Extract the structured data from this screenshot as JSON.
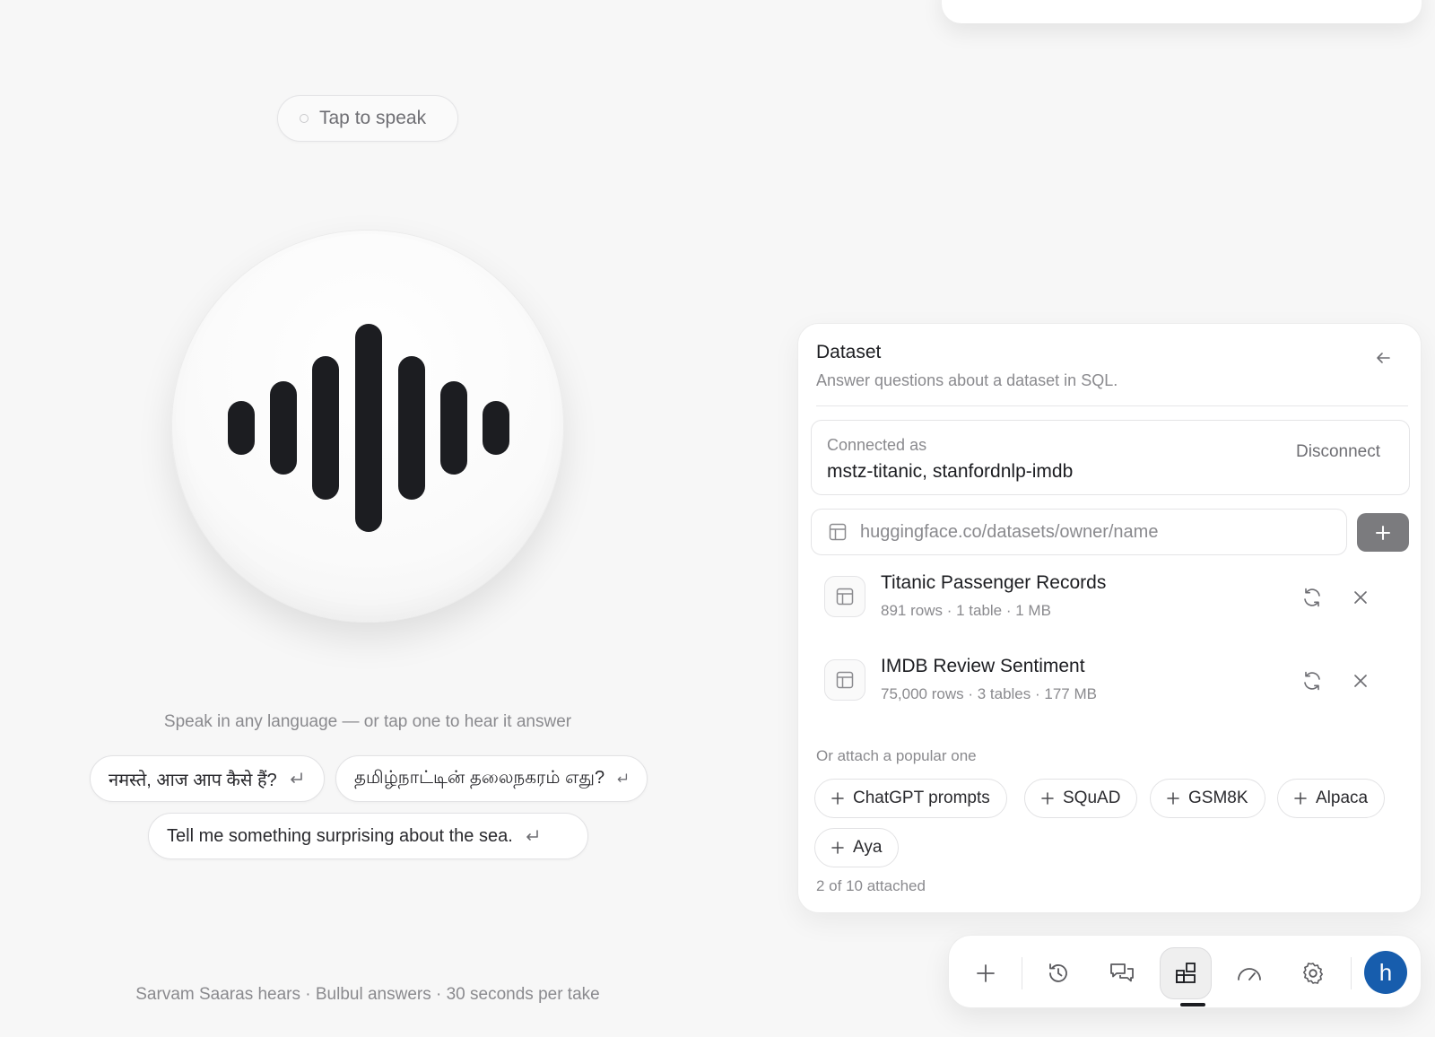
{
  "voice": {
    "tap_to_speak": "Tap to speak",
    "hint": "Speak in any language — or tap one to hear it answer",
    "suggestions": [
      "नमस्ते, आज आप कैसे हैं?",
      "தமிழ்நாட்டின் தலைநகரம் எது?",
      "Tell me something surprising about the sea."
    ],
    "footer": "Sarvam Saaras hears · Bulbul answers · 30 seconds per take"
  },
  "dataset_panel": {
    "title": "Dataset",
    "subtitle": "Answer questions about a dataset in SQL.",
    "connected_label": "Connected as",
    "connected_value": "mstz-titanic, stanfordnlp-imdb",
    "disconnect_label": "Disconnect",
    "url_placeholder": "huggingface.co/datasets/owner/name",
    "datasets": [
      {
        "name": "Titanic Passenger Records",
        "meta": "891 rows · 1 table · 1 MB"
      },
      {
        "name": "IMDB Review Sentiment",
        "meta": "75,000 rows · 3 tables · 177 MB"
      }
    ],
    "popular_label": "Or attach a popular one",
    "popular": [
      "ChatGPT prompts",
      "SQuAD",
      "GSM8K",
      "Alpaca",
      "Aya"
    ],
    "attached_count": "2 of 10 attached"
  },
  "toolbar": {
    "items": [
      "plus-icon",
      "history-icon",
      "chat-icon",
      "dataset-icon",
      "gauge-icon",
      "gear-icon"
    ],
    "active_item": "dataset-icon",
    "avatar_letter": "h",
    "avatar_color": "#175dad"
  },
  "colors": {
    "background": "#f7f7f7",
    "waveform": "#1c1d21",
    "add_button": "#7b7b7e"
  }
}
